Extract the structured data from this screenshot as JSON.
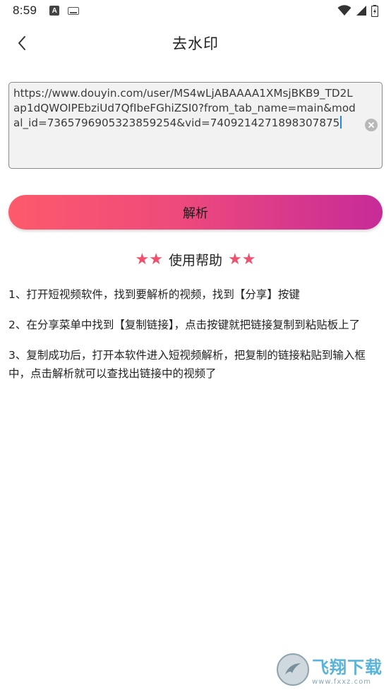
{
  "status_bar": {
    "time": "8:59",
    "notification_a": "A"
  },
  "header": {
    "title": "去水印"
  },
  "input": {
    "url": "https://www.douyin.com/user/MS4wLjABAAAA1XMsjBKB9_TD2Lap1dQWOIPEbziUd7QfIbeFGhiZSI0?from_tab_name=main&modal_id=7365796905323859254&vid=7409214271898307875"
  },
  "actions": {
    "parse_label": "解析"
  },
  "help": {
    "stars_left": "★★",
    "title": "使用帮助",
    "stars_right": "★★",
    "items": [
      "1、打开短视频软件，找到要解析的视频，找到【分享】按键",
      "2、在分享菜单中找到【复制链接】，点击按键就把链接复制到粘贴板上了",
      "3、复制成功后，打开本软件进入短视频解析，把复制的链接粘贴到输入框中，点击解析就可以查找出链接中的视频了"
    ]
  },
  "watermark": {
    "main": "飞翔下载",
    "url": "www.fxxz.com"
  },
  "colors": {
    "accent_start": "#fd5a6c",
    "accent_end": "#c72b98",
    "star": "#f0506e",
    "caret": "#1e88e5"
  }
}
